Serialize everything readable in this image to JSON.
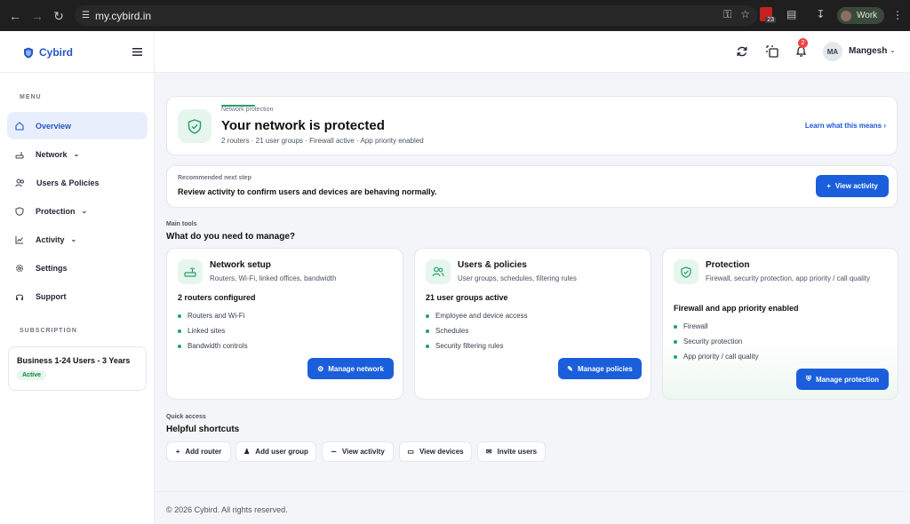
{
  "browser": {
    "url": "my.cybird.in",
    "calendar_badge": "23",
    "profile_label": "Work"
  },
  "sidebar": {
    "brand": "Cybird",
    "menu_heading": "MENU",
    "items": [
      {
        "label": "Overview",
        "icon": "home-icon",
        "active": true,
        "chevron": false
      },
      {
        "label": "Network",
        "icon": "router-icon",
        "active": false,
        "chevron": true
      },
      {
        "label": "Users & Policies",
        "icon": "users-icon",
        "active": false,
        "chevron": false
      },
      {
        "label": "Protection",
        "icon": "shield-icon",
        "active": false,
        "chevron": true
      },
      {
        "label": "Activity",
        "icon": "chart-line-icon",
        "active": false,
        "chevron": true
      },
      {
        "label": "Settings",
        "icon": "gear-icon",
        "active": false,
        "chevron": false
      },
      {
        "label": "Support",
        "icon": "headset-icon",
        "active": false,
        "chevron": false
      }
    ],
    "subscription_heading": "SUBSCRIPTION",
    "subscription": {
      "plan": "Business 1-24 Users - 3 Years",
      "status": "Active"
    }
  },
  "topbar": {
    "notification_count": "2",
    "avatar_initials": "MA",
    "user_name": "Mangesh"
  },
  "hero": {
    "label": "Network protection",
    "title": "Your network is protected",
    "subtitle": "2 routers · 21 user groups · Firewall active · App priority enabled",
    "link": "Learn what this means"
  },
  "next_step": {
    "label": "Recommended next step",
    "text": "Review activity to confirm users and devices are behaving normally.",
    "button": "View activity"
  },
  "main_tools": {
    "label": "Main tools",
    "heading": "What do you need to manage?",
    "cards": [
      {
        "title": "Network setup",
        "desc": "Routers, Wi-Fi, linked offices, bandwidth",
        "status": "2 routers configured",
        "bullets": [
          "Routers and Wi-Fi",
          "Linked sites",
          "Bandwidth controls"
        ],
        "button": "Manage network",
        "icon": "router-icon",
        "button_icon": "gear-icon"
      },
      {
        "title": "Users & policies",
        "desc": "User groups, schedules, filtering rules",
        "status": "21 user groups active",
        "bullets": [
          "Employee and device access",
          "Schedules",
          "Security filtering rules"
        ],
        "button": "Manage policies",
        "icon": "users-icon",
        "button_icon": "pencil-icon"
      },
      {
        "title": "Protection",
        "desc": "Firewall, security protection, app priority / call quality",
        "status": "Firewall and app priority enabled",
        "bullets": [
          "Firewall",
          "Security protection",
          "App priority / call quality"
        ],
        "button": "Manage protection",
        "icon": "shield-icon",
        "button_icon": "shield-icon"
      }
    ]
  },
  "quick_access": {
    "label": "Quick access",
    "heading": "Helpful shortcuts",
    "buttons": [
      {
        "label": "Add router",
        "icon": "plus-icon"
      },
      {
        "label": "Add user group",
        "icon": "user-plus-icon"
      },
      {
        "label": "View activity",
        "icon": "chart-line-icon"
      },
      {
        "label": "View devices",
        "icon": "laptop-icon"
      },
      {
        "label": "Invite users",
        "icon": "mail-icon"
      }
    ]
  },
  "footer": {
    "text": "© 2026 Cybird. All rights reserved."
  },
  "colors": {
    "accent": "#1a5edb",
    "brand": "#2456c4",
    "success": "#22a06b",
    "badge": "#ef4444"
  }
}
